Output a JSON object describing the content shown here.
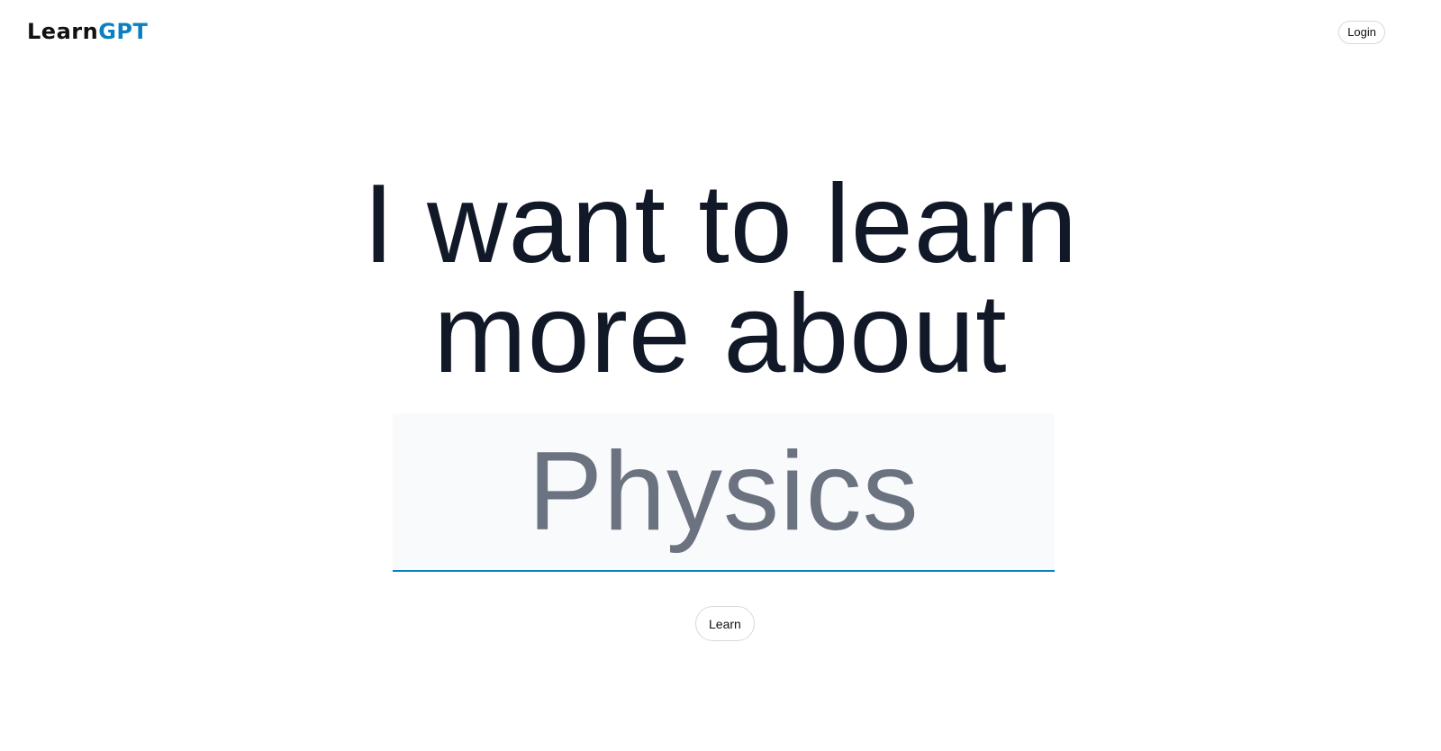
{
  "header": {
    "logo_primary": "Learn",
    "logo_accent": "GPT",
    "login_label": "Login"
  },
  "hero": {
    "line1": "I want to learn",
    "line2": "more about"
  },
  "topic": {
    "placeholder": "Physics",
    "value": ""
  },
  "actions": {
    "learn_label": "Learn"
  },
  "colors": {
    "accent": "#0b7fc0",
    "headline": "#111827",
    "placeholder": "#6b7280",
    "input_bg": "#f9fafb"
  }
}
